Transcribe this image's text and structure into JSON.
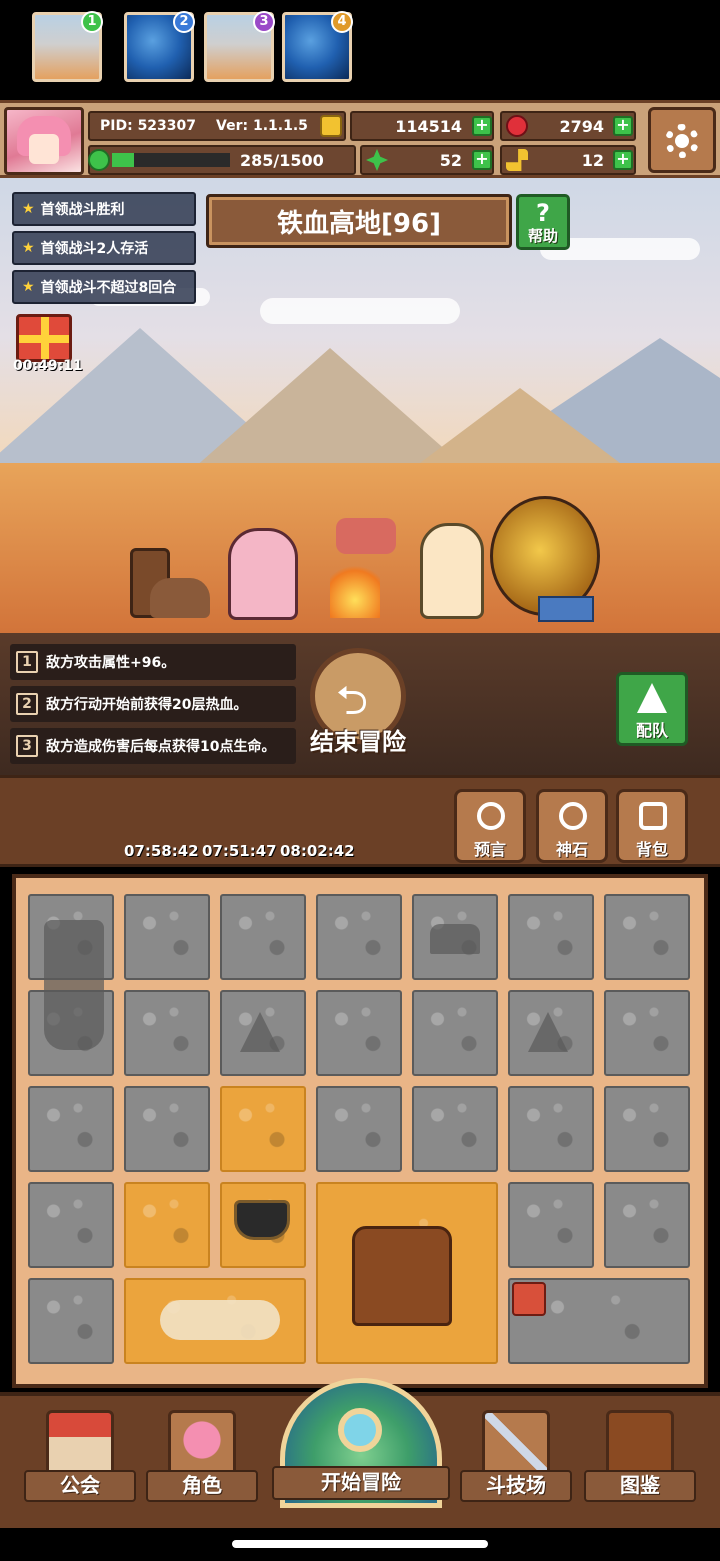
{
  "header": {
    "pid": "PID: 523307",
    "version": "Ver: 1.1.1.5",
    "gold": "114514",
    "gem": "2794",
    "stamina": "285/1500",
    "stamina_fraction": 0.19,
    "clover": "52",
    "key": "12",
    "icons": {
      "avatar": "pink-hair-girl-avatar",
      "gold": "gold-coin-icon",
      "gem": "red-gem-icon",
      "stamina": "green-clover-bar-icon",
      "clover": "clover-icon",
      "key": "gold-key-icon",
      "settings": "gear-icon"
    }
  },
  "quests": [
    "首领战斗胜利",
    "首领战斗2人存活",
    "首领战斗不超过8回合"
  ],
  "stage": {
    "title": "铁血高地[96]",
    "help_label": "帮助"
  },
  "gift_timer": "00:49:11",
  "rules": [
    {
      "num": "1",
      "text": "敌方攻击属性+96。"
    },
    {
      "num": "2",
      "text": "敌方行动开始前获得20层热血。"
    },
    {
      "num": "3",
      "text": "敌方造成伤害后每点获得10点生命。"
    }
  ],
  "end_button": "结束冒险",
  "team_button": "配队",
  "slots": [
    {
      "badge": "1",
      "timer": ""
    },
    {
      "badge": "2",
      "timer": "07:58:42"
    },
    {
      "badge": "3",
      "timer": "07:51:47"
    },
    {
      "badge": "4",
      "timer": "08:02:42"
    }
  ],
  "side_buttons": [
    "预言",
    "神石",
    "背包"
  ],
  "nav": {
    "guild": "公会",
    "character": "角色",
    "adventure": "开始冒险",
    "arena": "斗技场",
    "codex": "图鉴"
  },
  "colors": {
    "frame_brown": "#6b4026",
    "panel_brown": "#8a5a3a",
    "plus_green": "#3ec24a",
    "revealed_tile": "#eba43d",
    "unrevealed_tile": "#8a8a8a"
  }
}
